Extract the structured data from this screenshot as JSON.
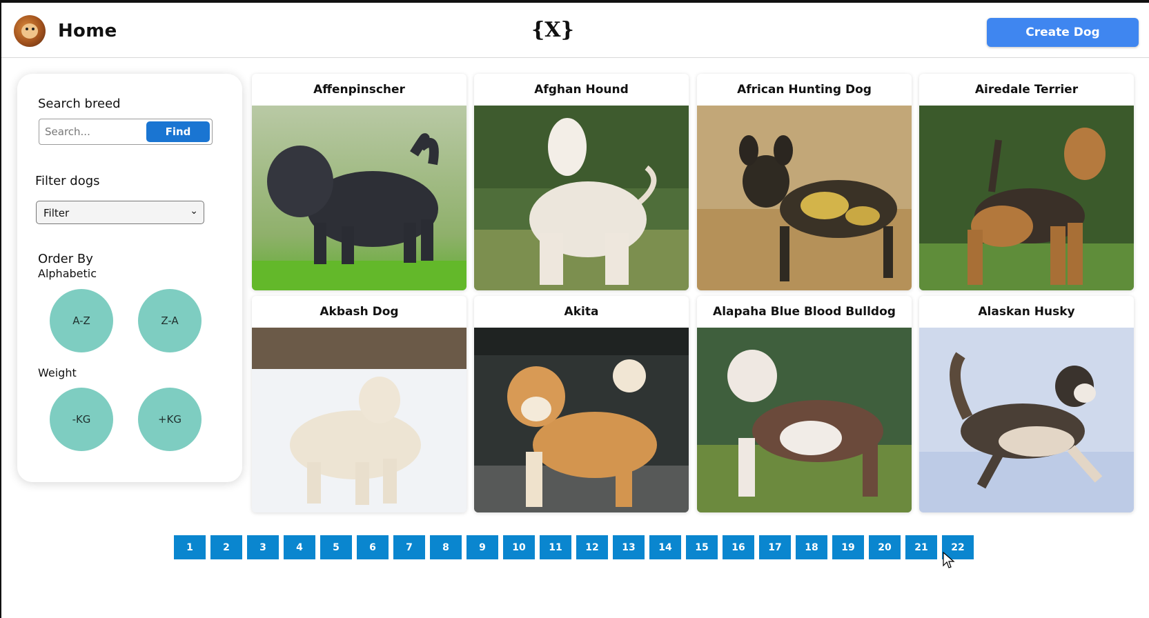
{
  "header": {
    "title": "Home",
    "logo_text": "{X}",
    "create_button": "Create Dog"
  },
  "sidebar": {
    "search_label": "Search breed",
    "search_placeholder": "Search...",
    "find_button": "Find",
    "filter_label": "Filter dogs",
    "filter_selected": "Filter",
    "order_label": "Order By",
    "alphabetic_label": "Alphabetic",
    "az_button": "A-Z",
    "za_button": "Z-A",
    "weight_label": "Weight",
    "minus_kg_button": "-KG",
    "plus_kg_button": "+KG"
  },
  "dogs": [
    {
      "name": "Affenpinscher"
    },
    {
      "name": "Afghan Hound"
    },
    {
      "name": "African Hunting Dog"
    },
    {
      "name": "Airedale Terrier"
    },
    {
      "name": "Akbash Dog"
    },
    {
      "name": "Akita"
    },
    {
      "name": "Alapaha Blue Blood Bulldog"
    },
    {
      "name": "Alaskan Husky"
    }
  ],
  "pagination": [
    "1",
    "2",
    "3",
    "4",
    "5",
    "6",
    "7",
    "8",
    "9",
    "10",
    "11",
    "12",
    "13",
    "14",
    "15",
    "16",
    "17",
    "18",
    "19",
    "20",
    "21",
    "22"
  ],
  "colors": {
    "create_button": "#3f86f0",
    "find_button": "#1a75d2",
    "circle_buttons": "#7ecdc1",
    "pagination": "#0a86cf"
  }
}
